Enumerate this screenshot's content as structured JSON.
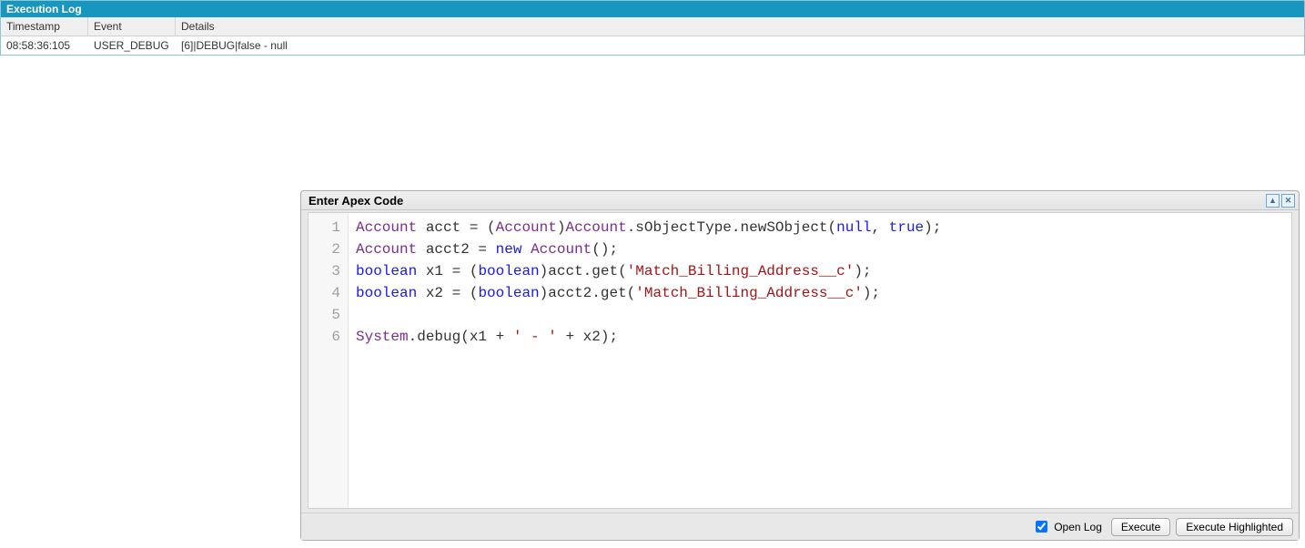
{
  "log": {
    "title": "Execution Log",
    "headers": {
      "timestamp": "Timestamp",
      "event": "Event",
      "details": "Details"
    },
    "rows": [
      {
        "timestamp": "08:58:36:105",
        "event": "USER_DEBUG",
        "details": "[6]|DEBUG|false - null"
      }
    ]
  },
  "apex": {
    "title": "Enter Apex Code",
    "lines": [
      {
        "n": "1"
      },
      {
        "n": "2"
      },
      {
        "n": "3"
      },
      {
        "n": "4"
      },
      {
        "n": "5"
      },
      {
        "n": "6"
      }
    ],
    "code": {
      "l1": {
        "t1": "Account",
        "rest": " acct = (",
        "t2": "Account",
        "rest2": ")",
        "t3": "Account",
        "rest3": ".sObjectType.newSObject(",
        "nul": "null",
        "comma": ", ",
        "tru": "true",
        "end": ");"
      },
      "l2": {
        "t1": "Account",
        "rest": " acct2 = ",
        "kw": "new",
        "sp": " ",
        "t2": "Account",
        "end": "();"
      },
      "l3": {
        "kw": "boolean",
        "rest": " x1 = (",
        "kw2": "boolean",
        "rest2": ")acct.get(",
        "str": "'Match_Billing_Address__c'",
        "end": ");"
      },
      "l4": {
        "kw": "boolean",
        "rest": " x2 = (",
        "kw2": "boolean",
        "rest2": ")acct2.get(",
        "str": "'Match_Billing_Address__c'",
        "end": ");"
      },
      "l5": "",
      "l6": {
        "sys": "System",
        "rest": ".debug(x1 + ",
        "str": "' - '",
        "rest2": " + x2);"
      }
    },
    "footer": {
      "openLog": "Open Log",
      "execute": "Execute",
      "executeHighlighted": "Execute Highlighted"
    }
  }
}
